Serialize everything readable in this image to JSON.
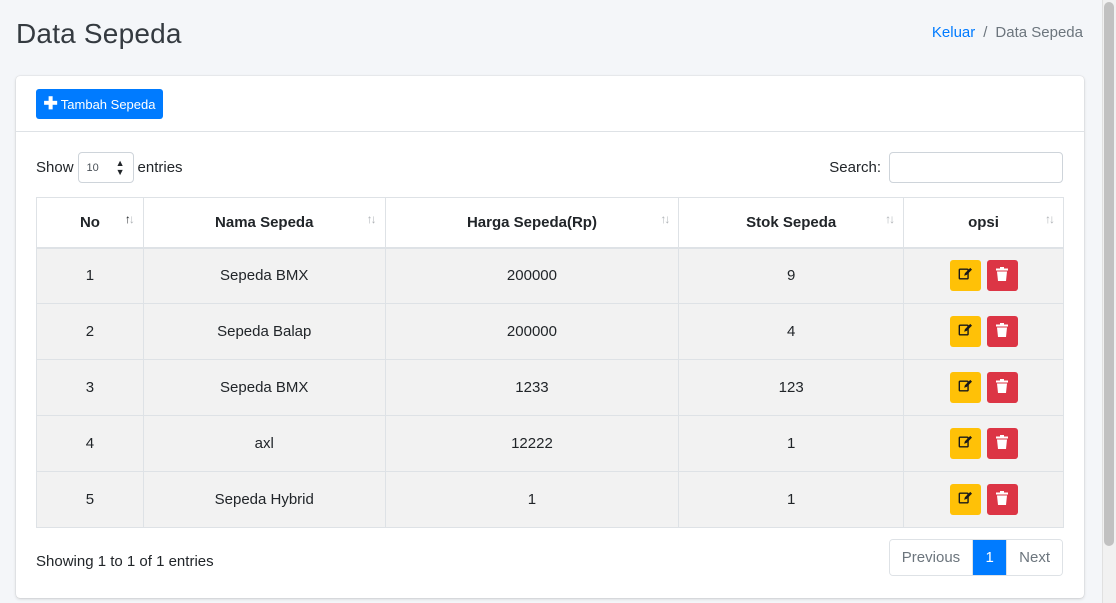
{
  "header": {
    "title": "Data Sepeda",
    "breadcrumb": {
      "link": "Keluar",
      "separator": "/",
      "current": "Data Sepeda"
    }
  },
  "toolbar": {
    "add_label": "Tambah Sepeda"
  },
  "table_controls": {
    "show_label": "Show",
    "entries_label": "entries",
    "length_value": "10",
    "search_label": "Search:",
    "search_value": ""
  },
  "table": {
    "columns": [
      "No",
      "Nama Sepeda",
      "Harga Sepeda(Rp)",
      "Stok Sepeda",
      "opsi"
    ],
    "rows": [
      {
        "no": "1",
        "nama": "Sepeda BMX",
        "harga": "200000",
        "stok": "9"
      },
      {
        "no": "2",
        "nama": "Sepeda Balap",
        "harga": "200000",
        "stok": "4"
      },
      {
        "no": "3",
        "nama": "Sepeda BMX",
        "harga": "1233",
        "stok": "123"
      },
      {
        "no": "4",
        "nama": "axl",
        "harga": "12222",
        "stok": "1"
      },
      {
        "no": "5",
        "nama": "Sepeda Hybrid",
        "harga": "1",
        "stok": "1"
      }
    ]
  },
  "footer": {
    "info": "Showing 1 to 1 of 1 entries",
    "pagination": {
      "previous": "Previous",
      "current": "1",
      "next": "Next"
    }
  },
  "icons": {
    "add": "plus-icon",
    "edit": "edit-icon",
    "delete": "trash-icon",
    "sort": "sort-icon"
  },
  "colors": {
    "primary": "#007bff",
    "warning": "#ffc107",
    "danger": "#dc3545",
    "row_bg": "#f2f2f2"
  }
}
